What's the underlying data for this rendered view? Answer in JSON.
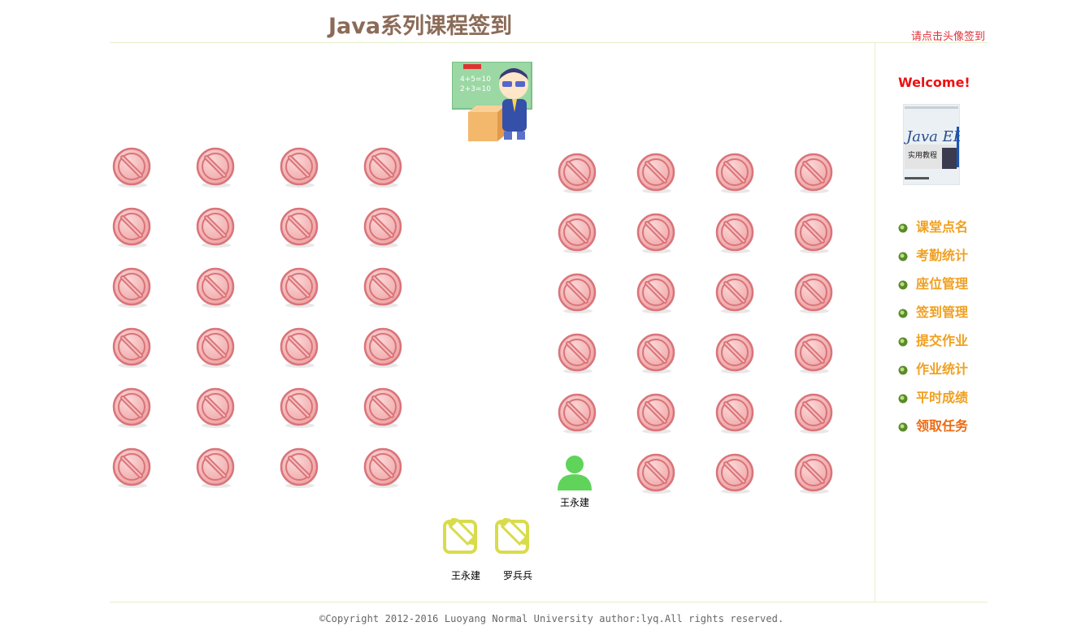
{
  "header": {
    "title": "Java系列课程签到",
    "hint": "请点击头像签到"
  },
  "seats": {
    "left": [
      [
        "empty",
        "empty",
        "empty",
        "empty"
      ],
      [
        "empty",
        "empty",
        "empty",
        "empty"
      ],
      [
        "empty",
        "empty",
        "empty",
        "empty"
      ],
      [
        "empty",
        "empty",
        "empty",
        "empty"
      ],
      [
        "empty",
        "empty",
        "empty",
        "empty"
      ],
      [
        "empty",
        "empty",
        "empty",
        "empty"
      ]
    ],
    "right": [
      [
        "empty",
        "empty",
        "empty",
        "empty"
      ],
      [
        "empty",
        "empty",
        "empty",
        "empty"
      ],
      [
        "empty",
        "empty",
        "empty",
        "empty"
      ],
      [
        "empty",
        "empty",
        "empty",
        "empty"
      ],
      [
        "empty",
        "empty",
        "empty",
        "empty"
      ],
      [
        "王永建",
        "empty",
        "empty",
        "empty"
      ]
    ]
  },
  "homework": [
    {
      "name": "王永建"
    },
    {
      "name": "罗兵兵"
    }
  ],
  "sidebar": {
    "welcome": "Welcome!",
    "menu": [
      "课堂点名",
      "考勤统计",
      "座位管理",
      "签到管理",
      "提交作业",
      "作业统计",
      "平时成绩",
      "领取任务"
    ]
  },
  "footer": "©Copyright 2012-2016 Luoyang Normal University author:lyq.All rights reserved.",
  "colors": {
    "accent": "#f0a020",
    "title": "#8b6b58",
    "hint": "#e0313a",
    "welcome": "#ee1010",
    "present": "#5fd35a",
    "homework": "#d9dc4a"
  }
}
